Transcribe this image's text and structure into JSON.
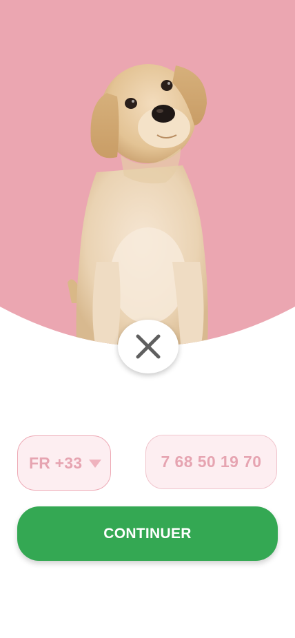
{
  "hero": {
    "image": "labrador-puppy-photo",
    "background_color": "#eba6b1"
  },
  "close_button": {
    "icon": "close-icon"
  },
  "phone_form": {
    "country_code_label": "FR +33",
    "country_caret_icon": "caret-down-icon",
    "phone_value": "7 68 50 19 70"
  },
  "actions": {
    "continue_label": "CONTINUER"
  },
  "colors": {
    "accent_green": "#34a853",
    "field_background": "#fdeef1",
    "field_text": "#e6a4b1",
    "hero_pink": "#eba6b1"
  }
}
